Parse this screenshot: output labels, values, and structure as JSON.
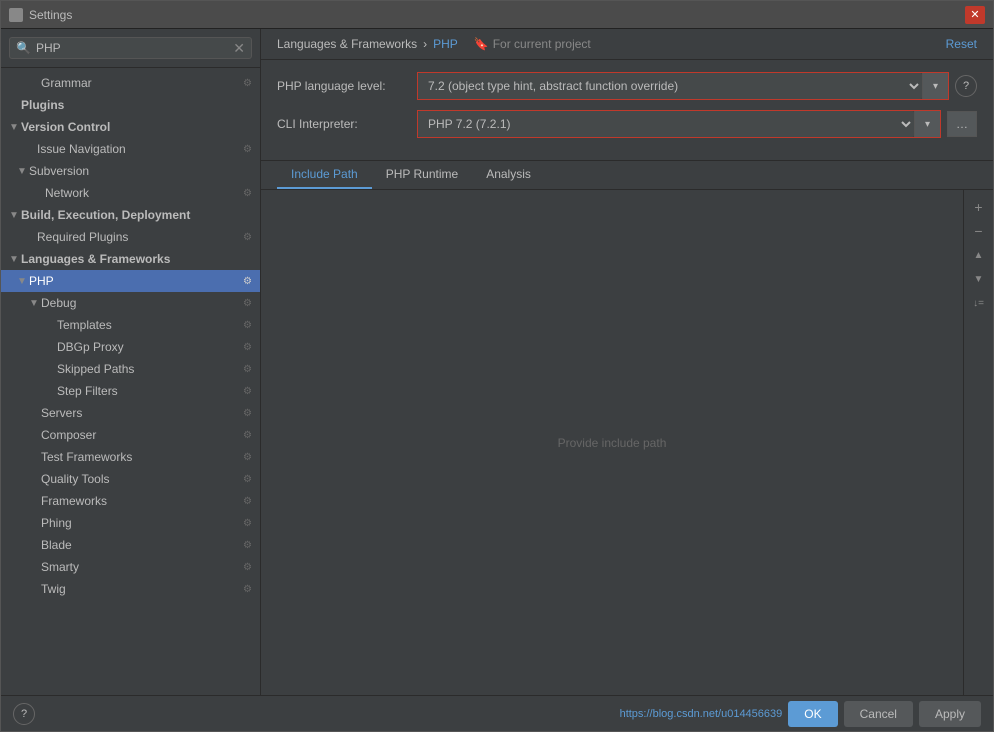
{
  "window": {
    "title": "Settings"
  },
  "search": {
    "value": "PHP",
    "placeholder": "PHP"
  },
  "sidebar": {
    "items": [
      {
        "id": "grammar",
        "label": "Grammar",
        "level": 2,
        "arrow": "",
        "selected": false,
        "hasIcon": true
      },
      {
        "id": "plugins",
        "label": "Plugins",
        "level": 0,
        "arrow": "",
        "selected": false,
        "hasIcon": false,
        "bold": true
      },
      {
        "id": "version-control",
        "label": "Version Control",
        "level": 0,
        "arrow": "▼",
        "selected": false,
        "hasIcon": false,
        "bold": true
      },
      {
        "id": "issue-navigation",
        "label": "Issue Navigation",
        "level": 1,
        "arrow": "",
        "selected": false,
        "hasIcon": true
      },
      {
        "id": "subversion",
        "label": "Subversion",
        "level": 1,
        "arrow": "▼",
        "selected": false,
        "hasIcon": false
      },
      {
        "id": "network",
        "label": "Network",
        "level": 2,
        "arrow": "",
        "selected": false,
        "hasIcon": true
      },
      {
        "id": "build-execution",
        "label": "Build, Execution, Deployment",
        "level": 0,
        "arrow": "▼",
        "selected": false,
        "hasIcon": false,
        "bold": true
      },
      {
        "id": "required-plugins",
        "label": "Required Plugins",
        "level": 1,
        "arrow": "",
        "selected": false,
        "hasIcon": true
      },
      {
        "id": "languages-frameworks",
        "label": "Languages & Frameworks",
        "level": 0,
        "arrow": "▼",
        "selected": false,
        "hasIcon": false,
        "bold": true
      },
      {
        "id": "php",
        "label": "PHP",
        "level": 1,
        "arrow": "▼",
        "selected": true,
        "hasIcon": true
      },
      {
        "id": "debug",
        "label": "Debug",
        "level": 2,
        "arrow": "▼",
        "selected": false,
        "hasIcon": true
      },
      {
        "id": "templates",
        "label": "Templates",
        "level": 3,
        "arrow": "",
        "selected": false,
        "hasIcon": true
      },
      {
        "id": "dbgp-proxy",
        "label": "DBGp Proxy",
        "level": 3,
        "arrow": "",
        "selected": false,
        "hasIcon": true
      },
      {
        "id": "skipped-paths",
        "label": "Skipped Paths",
        "level": 3,
        "arrow": "",
        "selected": false,
        "hasIcon": true
      },
      {
        "id": "step-filters",
        "label": "Step Filters",
        "level": 3,
        "arrow": "",
        "selected": false,
        "hasIcon": true
      },
      {
        "id": "servers",
        "label": "Servers",
        "level": 2,
        "arrow": "",
        "selected": false,
        "hasIcon": true
      },
      {
        "id": "composer",
        "label": "Composer",
        "level": 2,
        "arrow": "",
        "selected": false,
        "hasIcon": true
      },
      {
        "id": "test-frameworks",
        "label": "Test Frameworks",
        "level": 2,
        "arrow": "",
        "selected": false,
        "hasIcon": true
      },
      {
        "id": "quality-tools",
        "label": "Quality Tools",
        "level": 2,
        "arrow": "",
        "selected": false,
        "hasIcon": true
      },
      {
        "id": "frameworks",
        "label": "Frameworks",
        "level": 2,
        "arrow": "",
        "selected": false,
        "hasIcon": true
      },
      {
        "id": "phing",
        "label": "Phing",
        "level": 2,
        "arrow": "",
        "selected": false,
        "hasIcon": true
      },
      {
        "id": "blade",
        "label": "Blade",
        "level": 2,
        "arrow": "",
        "selected": false,
        "hasIcon": true
      },
      {
        "id": "smarty",
        "label": "Smarty",
        "level": 2,
        "arrow": "",
        "selected": false,
        "hasIcon": true
      },
      {
        "id": "twig",
        "label": "Twig",
        "level": 2,
        "arrow": "",
        "selected": false,
        "hasIcon": true
      }
    ]
  },
  "main": {
    "breadcrumb": {
      "parent": "Languages & Frameworks",
      "separator": "›",
      "current": "PHP"
    },
    "for_project_label": "For current project",
    "reset_label": "Reset",
    "php_language_level_label": "PHP language level:",
    "php_language_level_value": "7.2 (object type hint, abstract function override)",
    "cli_interpreter_label": "CLI Interpreter:",
    "cli_interpreter_value": "PHP 7.2 (7.2.1)",
    "tabs": [
      {
        "id": "include-path",
        "label": "Include Path",
        "active": true
      },
      {
        "id": "php-runtime",
        "label": "PHP Runtime",
        "active": false
      },
      {
        "id": "analysis",
        "label": "Analysis",
        "active": false
      }
    ],
    "empty_hint": "Provide include path"
  },
  "bottom": {
    "ok_label": "OK",
    "cancel_label": "Cancel",
    "apply_label": "Apply",
    "url": "https://blog.csdn.net/u014456639"
  },
  "buttons": {
    "add": "+",
    "remove": "−",
    "up": "▲",
    "down": "▼",
    "sort": "↓="
  }
}
